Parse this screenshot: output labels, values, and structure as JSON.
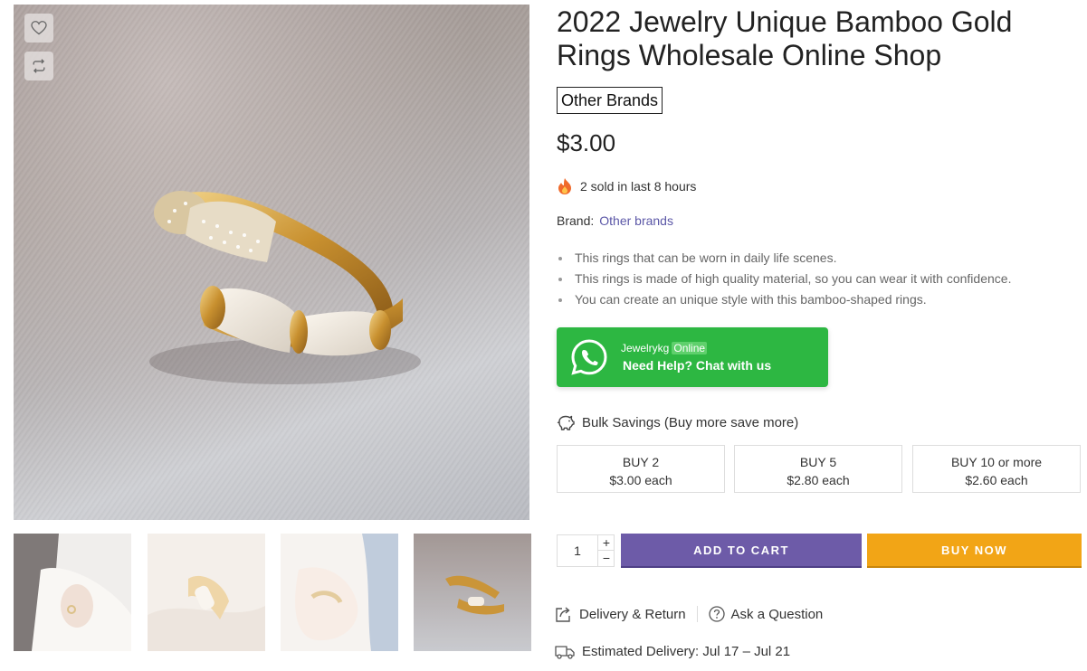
{
  "gallery": {
    "main_image_alt": "",
    "wishlist_icon": "heart-icon",
    "compare_icon": "compare-icon",
    "thumbnails": [
      {
        "name": "thumbnail-1"
      },
      {
        "name": "thumbnail-2"
      },
      {
        "name": "thumbnail-3"
      },
      {
        "name": "thumbnail-4"
      }
    ]
  },
  "product": {
    "title": "2022 Jewelry Unique Bamboo Gold Rings Wholesale Online Shop",
    "brand_badge": "Other Brands",
    "price": "$3.00",
    "sold_text": "2 sold in last 8 hours",
    "sold_icon": "fire-icon",
    "brand_label": "Brand:",
    "brand_value": "Other brands",
    "bullets": [
      "This rings that can be worn in daily life scenes.",
      "This rings is made of high quality material, so you can wear it with confidence.",
      "You can create an unique style with this bamboo-shaped rings."
    ]
  },
  "whatsapp": {
    "name": "Jewelrykg",
    "status": "Online",
    "help_text": "Need Help? Chat with us",
    "icon": "whatsapp-icon",
    "color": "#2db742"
  },
  "bulk": {
    "title": "Bulk Savings (Buy more save more)",
    "icon": "piggy-bank-icon",
    "tiers": [
      {
        "qty": "BUY 2",
        "price": "$3.00 each"
      },
      {
        "qty": "BUY 5",
        "price": "$2.80 each"
      },
      {
        "qty": "BUY 10 or more",
        "price": "$2.60 each"
      }
    ]
  },
  "purchase": {
    "quantity": "1",
    "plus": "+",
    "minus": "−",
    "add_to_cart": "ADD TO CART",
    "buy_now": "BUY NOW",
    "add_to_cart_color": "#6d5ba8",
    "buy_now_color": "#f2a516"
  },
  "links": {
    "delivery_return": "Delivery & Return",
    "ask_question": "Ask a Question",
    "estimated_delivery": "Estimated Delivery: Jul 17 – Jul 21"
  }
}
